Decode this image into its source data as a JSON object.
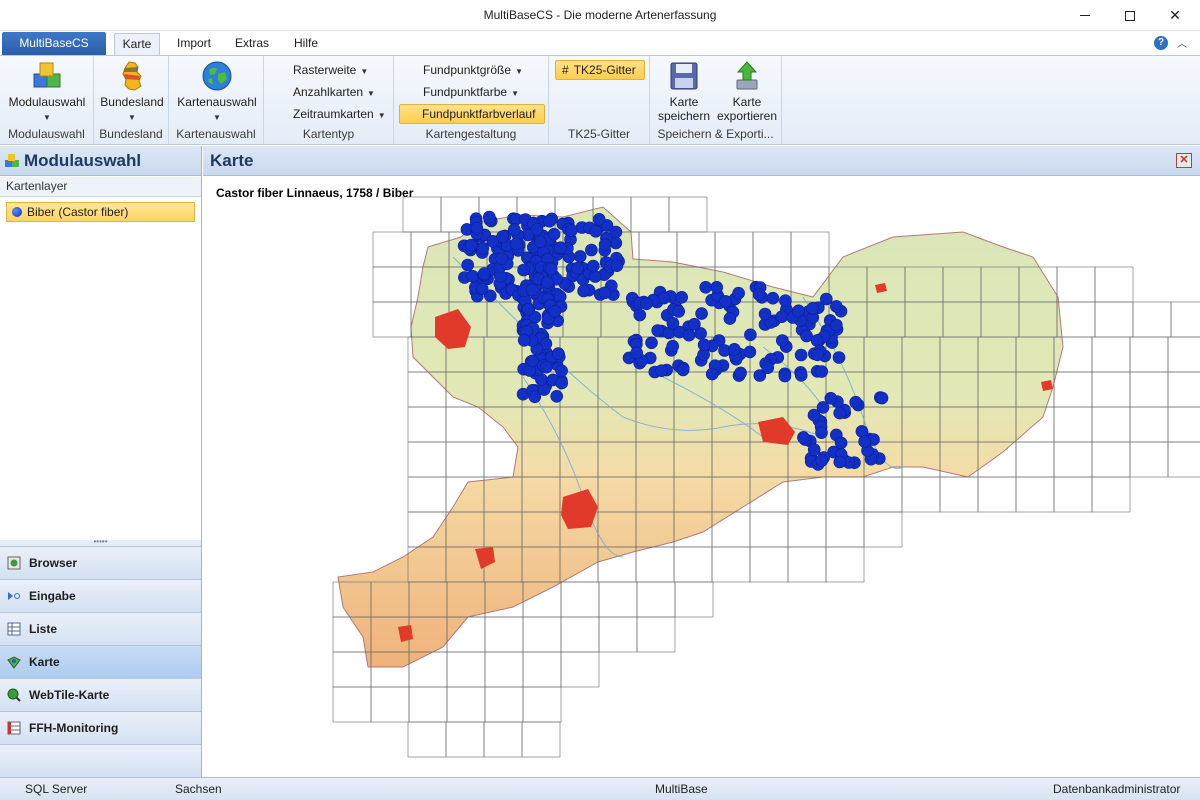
{
  "window": {
    "title": "MultiBaseCS - Die moderne Artenerfassung"
  },
  "ribbon_tabs": {
    "app_tab": "MultiBaseCS",
    "tabs": [
      "Karte",
      "Import",
      "Extras",
      "Hilfe"
    ],
    "active": "Karte",
    "help": "?"
  },
  "ribbon": {
    "groups": {
      "modulauswahl": {
        "button": "Modulauswahl",
        "label": "Modulauswahl"
      },
      "bundesland": {
        "button": "Bundesland",
        "label": "Bundesland"
      },
      "kartenauswahl": {
        "button": "Kartenauswahl",
        "label": "Kartenauswahl"
      },
      "kartentyp": {
        "items": [
          "Rasterweite",
          "Anzahlkarten",
          "Zeitraumkarten"
        ],
        "label": "Kartentyp"
      },
      "kartengestaltung": {
        "items": [
          "Fundpunktgröße",
          "Fundpunktfarbe",
          "Fundpunktfarbverlauf"
        ],
        "label": "Kartengestaltung"
      },
      "tk25": {
        "button": "TK25-Gitter",
        "label": "TK25-Gitter"
      },
      "speichern": {
        "save_line1": "Karte",
        "save_line2": "speichern",
        "export_line1": "Karte",
        "export_line2": "exportieren",
        "label": "Speichern & Exporti..."
      }
    }
  },
  "left_panel": {
    "title": "Modulauswahl",
    "section": "Kartenlayer",
    "layer": "Biber (Castor fiber)",
    "splitter": "•••••",
    "nav": [
      "Browser",
      "Eingabe",
      "Liste",
      "Karte",
      "WebTile-Karte",
      "FFH-Monitoring"
    ],
    "nav_selected": "Karte"
  },
  "main": {
    "title": "Karte",
    "close": "✕",
    "map_title": "Castor fiber Linnaeus, 1758 / Biber",
    "colors": {
      "point": "#1230c8",
      "city": "#e23a2a",
      "lowland": "#dfe8b8",
      "highland": "#f3c891",
      "grid": "#6a6a6a"
    },
    "points_shown": 420
  },
  "statusbar": {
    "server": "SQL Server",
    "state": "Sachsen",
    "app": "MultiBase",
    "user": "Datenbankadministrator"
  }
}
